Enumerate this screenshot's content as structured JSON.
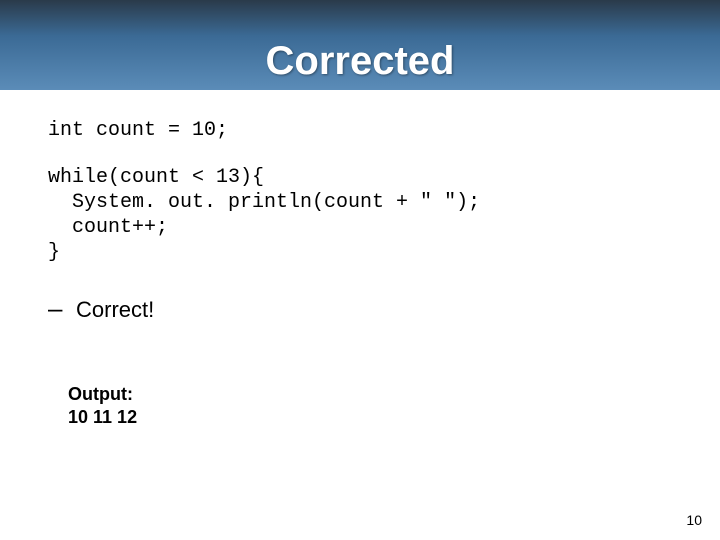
{
  "header": {
    "title": "Corrected"
  },
  "code": {
    "line1": "int count = 10;",
    "block2": "while(count < 13){\n  System. out. println(count + \" \");\n  count++;\n}"
  },
  "bullet": {
    "dash": "–",
    "text": "Correct!"
  },
  "output": {
    "label": "Output:",
    "values": "10 11 12"
  },
  "slide_number": "10"
}
